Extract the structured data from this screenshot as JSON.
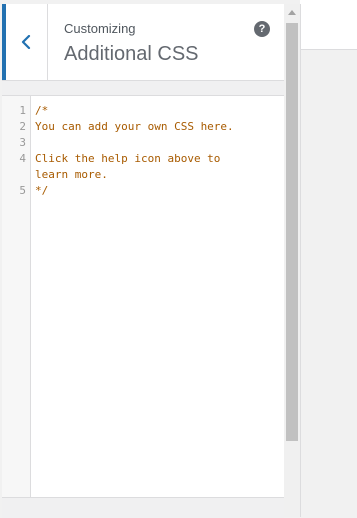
{
  "header": {
    "eyebrow": "Customizing",
    "title": "Additional CSS",
    "back_icon": "chevron-left-icon",
    "help_icon": "help-icon",
    "help_glyph": "?"
  },
  "editor": {
    "lines": [
      {
        "number": "1",
        "text": "/*"
      },
      {
        "number": "2",
        "text": "You can add your own CSS here."
      },
      {
        "number": "3",
        "text": ""
      },
      {
        "number": "4",
        "text": "Click the help icon above to"
      },
      {
        "number": "",
        "text": "learn more."
      },
      {
        "number": "5",
        "text": "*/"
      }
    ]
  },
  "colors": {
    "accent": "#2271b1",
    "comment": "#a85b00",
    "line_number": "#999999"
  }
}
